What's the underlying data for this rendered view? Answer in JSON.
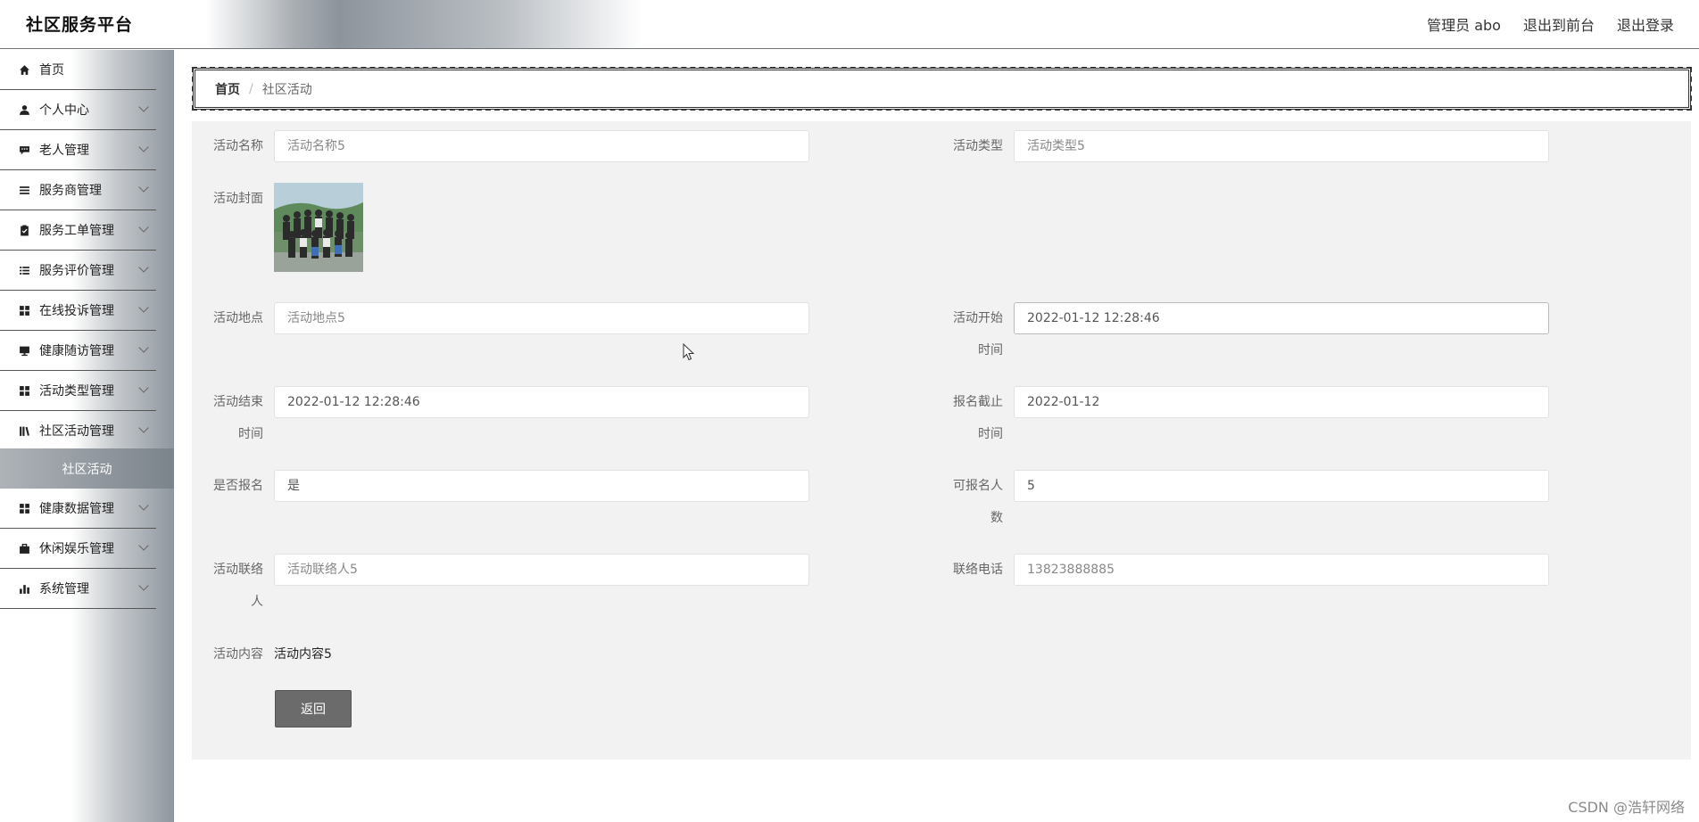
{
  "header": {
    "brand": "社区服务平台",
    "user": "管理员 abo",
    "front": "退出到前台",
    "logout": "退出登录"
  },
  "sidebar": {
    "items": [
      {
        "label": "首页",
        "icon": "home-icon",
        "chevron": false
      },
      {
        "label": "个人中心",
        "icon": "user-icon",
        "chevron": true
      },
      {
        "label": "老人管理",
        "icon": "chat-icon",
        "chevron": true
      },
      {
        "label": "服务商管理",
        "icon": "list-icon",
        "chevron": true
      },
      {
        "label": "服务工单管理",
        "icon": "clipboard-icon",
        "chevron": true
      },
      {
        "label": "服务评价管理",
        "icon": "list-icon",
        "chevron": true
      },
      {
        "label": "在线投诉管理",
        "icon": "grid-icon",
        "chevron": true
      },
      {
        "label": "健康随访管理",
        "icon": "monitor-icon",
        "chevron": true
      },
      {
        "label": "活动类型管理",
        "icon": "grid-icon",
        "chevron": true
      },
      {
        "label": "社区活动管理",
        "icon": "library-icon",
        "chevron": true
      },
      {
        "label": "健康数据管理",
        "icon": "grid-icon",
        "chevron": true
      },
      {
        "label": "休闲娱乐管理",
        "icon": "briefcase-icon",
        "chevron": true
      },
      {
        "label": "系统管理",
        "icon": "bar-chart-icon",
        "chevron": true
      }
    ],
    "submenu_active": "社区活动"
  },
  "breadcrumb": {
    "home": "首页",
    "sep": "/",
    "current": "社区活动"
  },
  "form": {
    "name_label": "活动名称",
    "name_value": "活动名称5",
    "type_label": "活动类型",
    "type_value": "活动类型5",
    "cover_label": "活动封面",
    "place_label": "活动地点",
    "place_value": "活动地点5",
    "start_label_1": "活动开始",
    "start_label_2": "时间",
    "start_value": "2022-01-12 12:28:46",
    "end_label_1": "活动结束",
    "end_label_2": "时间",
    "end_value": "2022-01-12 12:28:46",
    "deadline_label_1": "报名截止",
    "deadline_label_2": "时间",
    "deadline_value": "2022-01-12",
    "signup_label": "是否报名",
    "signup_value": "是",
    "capacity_label_1": "可报名人",
    "capacity_label_2": "数",
    "capacity_value": "5",
    "contact_label_1": "活动联络",
    "contact_label_2": "人",
    "contact_value": "活动联络人5",
    "phone_label": "联络电话",
    "phone_value": "13823888885",
    "content_label": "活动内容",
    "content_value": "活动内容5",
    "back_button": "返回"
  },
  "watermark": "CSDN @浩轩网络"
}
